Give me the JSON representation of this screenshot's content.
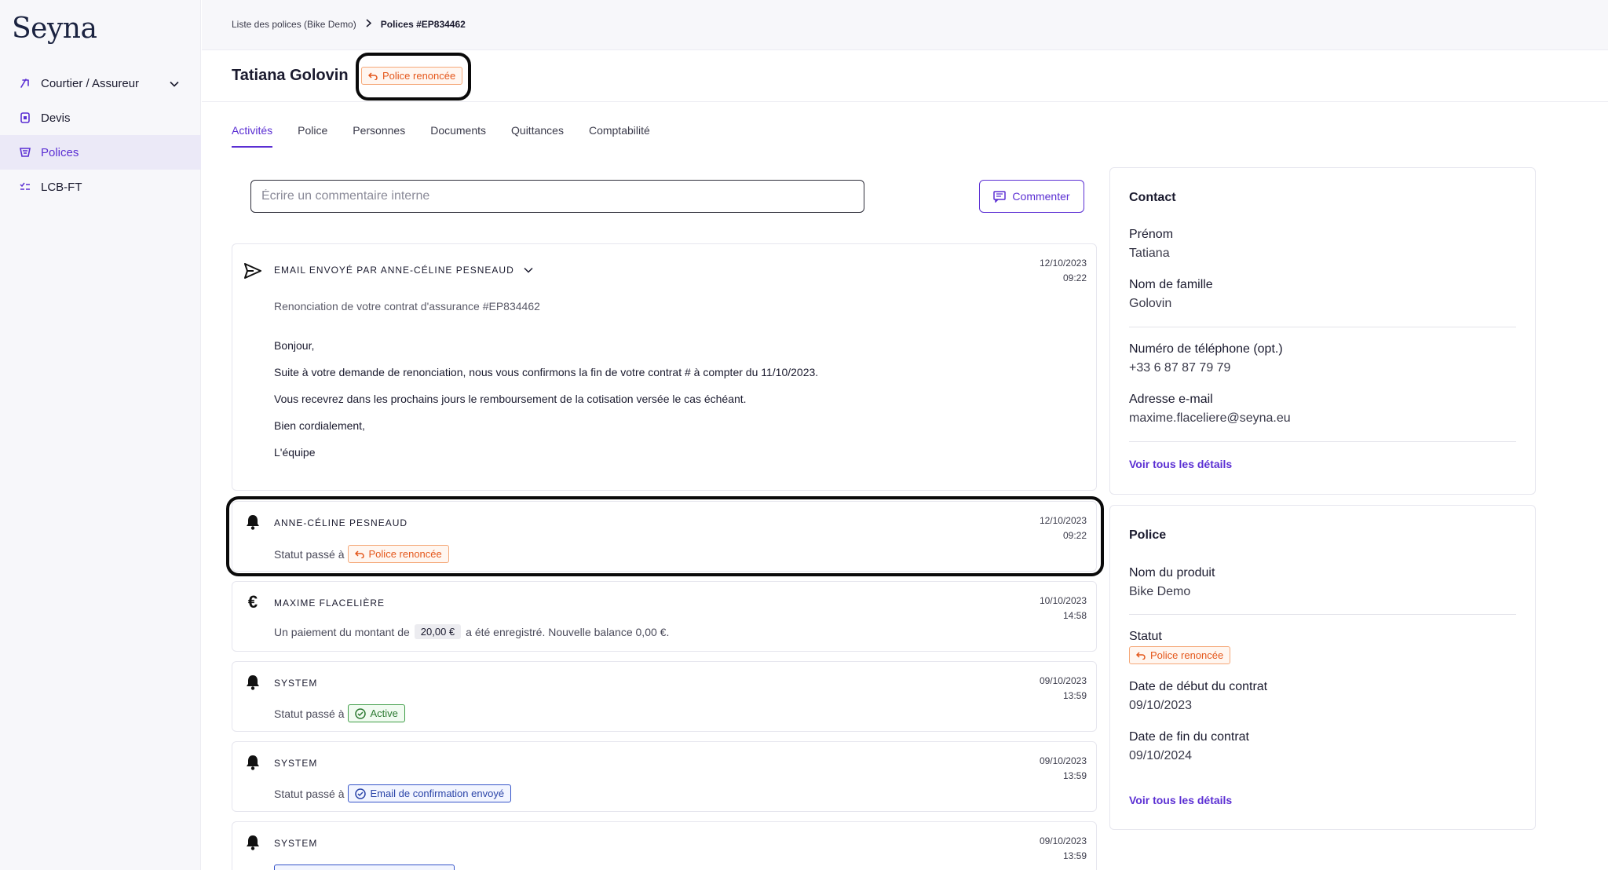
{
  "app": {
    "logo": "Seyna"
  },
  "sidebar": {
    "items": [
      {
        "label": "Courtier / Assureur"
      },
      {
        "label": "Devis"
      },
      {
        "label": "Polices"
      },
      {
        "label": "LCB-FT"
      }
    ]
  },
  "breadcrumb": {
    "parent": "Liste des polices (Bike Demo)",
    "current": "Polices #EP834462"
  },
  "header": {
    "title": "Tatiana Golovin",
    "status": "Police renoncée"
  },
  "tabs": [
    {
      "label": "Activités"
    },
    {
      "label": "Police"
    },
    {
      "label": "Personnes"
    },
    {
      "label": "Documents"
    },
    {
      "label": "Quittances"
    },
    {
      "label": "Comptabilité"
    }
  ],
  "comment": {
    "placeholder": "Écrire un commentaire interne",
    "button": "Commenter"
  },
  "activities": [
    {
      "type": "email",
      "title": "EMAIL ENVOYÉ PAR ANNE-CÉLINE PESNEAUD",
      "date": "12/10/2023",
      "time": "09:22",
      "subject": "Renonciation de votre contrat d'assurance #EP834462",
      "lines": [
        "Bonjour,",
        "Suite à votre demande de renonciation, nous vous confirmons la fin de votre contrat # à compter du 11/10/2023.",
        "Vous recevrez dans les prochains jours le remboursement de la cotisation versée le cas échéant.",
        "Bien cordialement,",
        "L'équipe"
      ]
    },
    {
      "type": "status",
      "title": "ANNE-CÉLINE PESNEAUD",
      "date": "12/10/2023",
      "time": "09:22",
      "label": "Statut passé à",
      "badge": "Police renoncée"
    },
    {
      "type": "payment",
      "title": "MAXIME FLACELIÈRE",
      "date": "10/10/2023",
      "time": "14:58",
      "before": "Un paiement du montant de",
      "amount": "20,00 €",
      "after": "a été enregistré. Nouvelle balance 0,00 €."
    },
    {
      "type": "status",
      "title": "SYSTEM",
      "date": "09/10/2023",
      "time": "13:59",
      "label": "Statut passé à",
      "badge": "Active"
    },
    {
      "type": "status",
      "title": "SYSTEM",
      "date": "09/10/2023",
      "time": "13:59",
      "label": "Statut passé à",
      "badge": "Email de confirmation envoyé"
    },
    {
      "type": "status",
      "title": "SYSTEM",
      "date": "09/10/2023",
      "time": "13:59"
    }
  ],
  "contact": {
    "title": "Contact",
    "first_name_label": "Prénom",
    "first_name": "Tatiana",
    "last_name_label": "Nom de famille",
    "last_name": "Golovin",
    "phone_label": "Numéro de téléphone (opt.)",
    "phone": "+33 6 87 87 79 79",
    "email_label": "Adresse e-mail",
    "email": "maxime.flaceliere@seyna.eu",
    "link": "Voir tous les détails"
  },
  "policy": {
    "title": "Police",
    "product_label": "Nom du produit",
    "product": "Bike Demo",
    "status_label": "Statut",
    "status": "Police renoncée",
    "start_label": "Date de début du contrat",
    "start": "09/10/2023",
    "end_label": "Date de fin du contrat",
    "end": "09/10/2024",
    "link": "Voir tous les détails"
  },
  "colors": {
    "accent": "#5b2fd3",
    "cancel": "#e4571b",
    "active": "#2c7a32",
    "info": "#2a44a8"
  }
}
